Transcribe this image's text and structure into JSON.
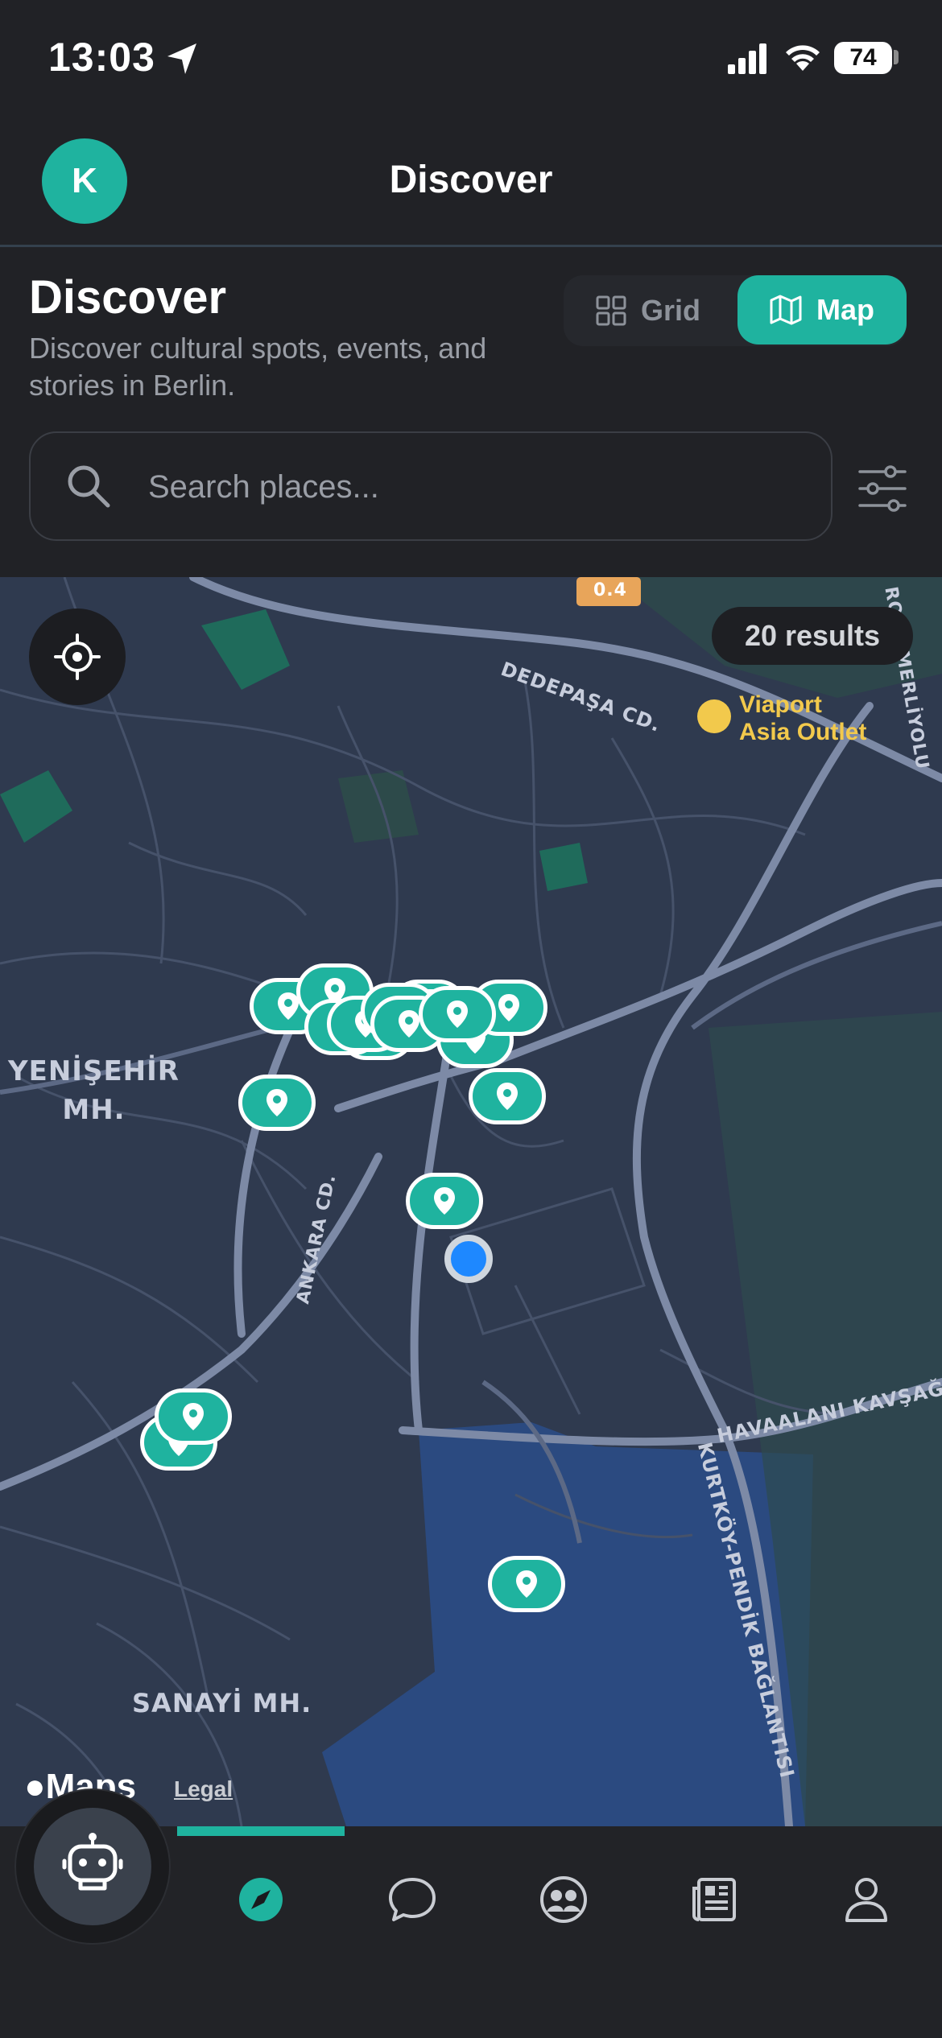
{
  "status_bar": {
    "time": "13:03",
    "battery": "74"
  },
  "header": {
    "avatar_initial": "K",
    "title": "Discover"
  },
  "discover": {
    "title": "Discover",
    "subtitle": "Discover cultural spots, events, and stories in Berlin.",
    "view_toggle": {
      "grid_label": "Grid",
      "map_label": "Map",
      "selected": "Map"
    }
  },
  "search": {
    "placeholder": "Search places..."
  },
  "map": {
    "results_count": "20 results",
    "labels": {
      "road_dedepasa": "DEDEPAŞA CD.",
      "poi": "Viaport\nAsia Outlet",
      "road_top_right": "ROY-ÖMERLİYOLU",
      "district_yenisehir": "YENİŞEHİR\nMH.",
      "road_ankara": "ANKARA CD.",
      "road_havaalani": "HAVAALANI KAVŞAĞ",
      "road_kurtkoy": "KURTKÖY-PENDİK BAĞLANTISI",
      "district_sanayi": "SANAYİ MH.",
      "road_shield": "0.4"
    },
    "attribution": {
      "logo": "Maps",
      "legal": "Legal"
    }
  },
  "tab_bar": {
    "active": "discover",
    "items": [
      "discover",
      "chat",
      "community",
      "news",
      "profile"
    ]
  },
  "colors": {
    "accent": "#1fb39f",
    "background": "#212226",
    "map_bg": "#2f3a4f",
    "user_location": "#1e88ff"
  }
}
